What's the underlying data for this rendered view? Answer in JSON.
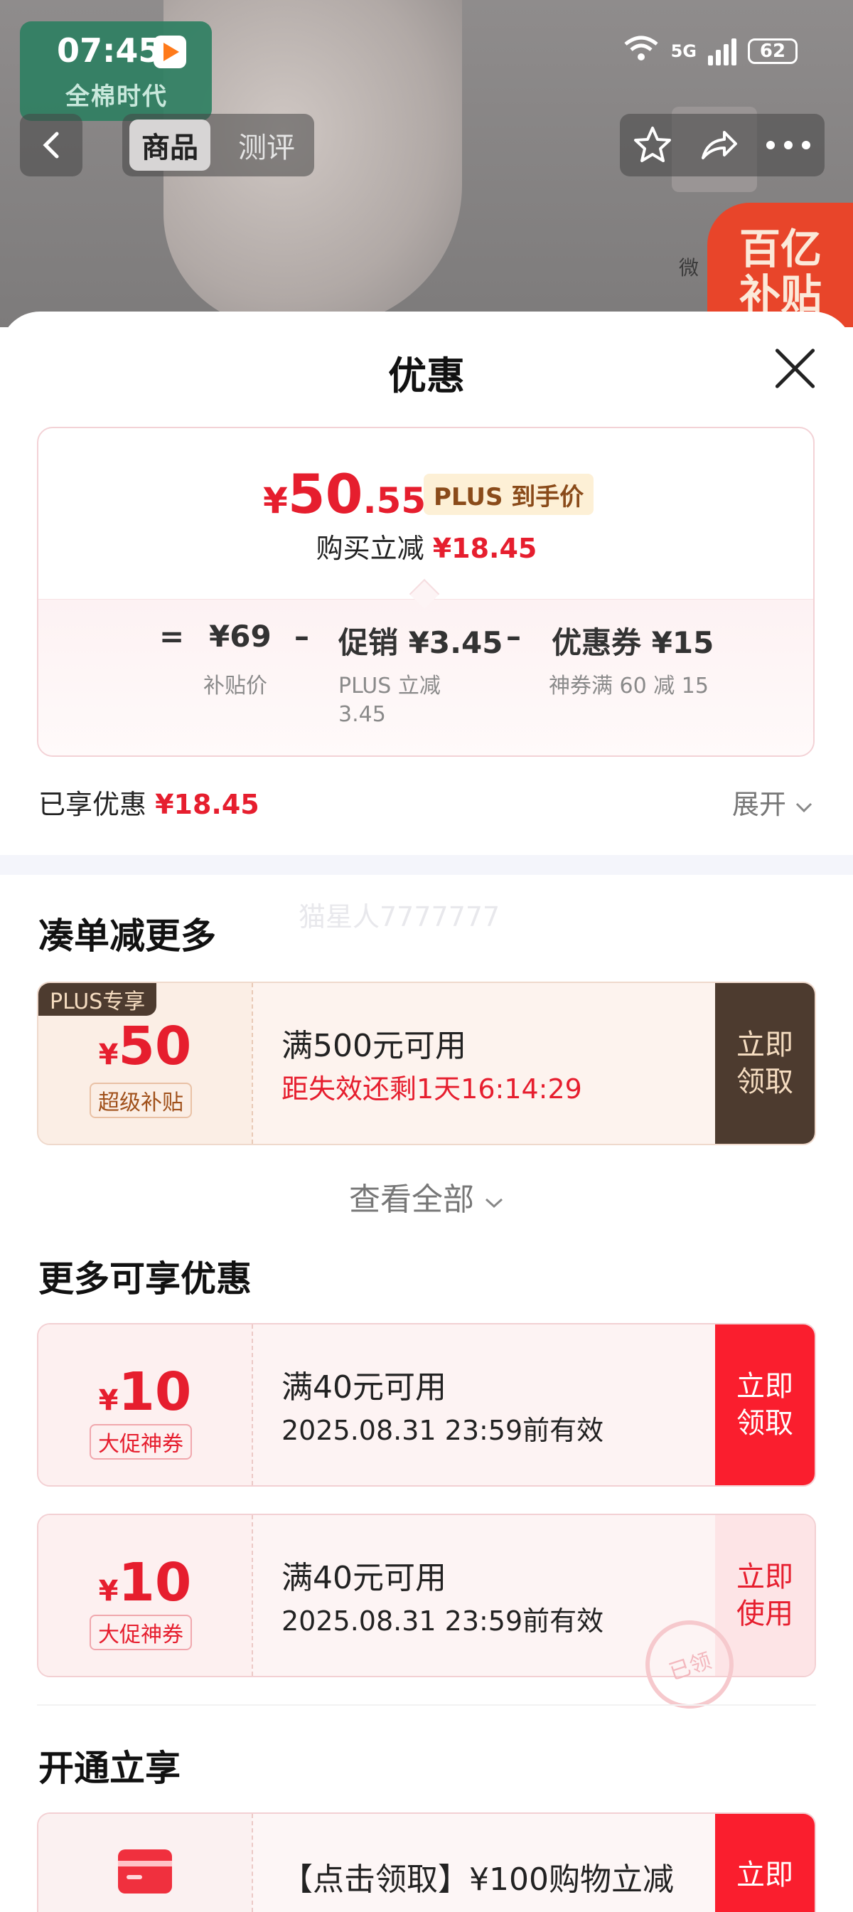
{
  "status_bar": {
    "time": "07:45",
    "network": "5G",
    "battery": "62"
  },
  "product_bg": {
    "brand_subtitle": "全棉时代",
    "thumb_label": "微",
    "subsidy_badge": [
      "百亿",
      "补贴"
    ]
  },
  "nav": {
    "tabs": [
      "商品",
      "测评"
    ],
    "active_tab": "商品"
  },
  "sheet": {
    "title": "优惠"
  },
  "summary": {
    "currency": "¥",
    "price_int": "50",
    "price_dec": ".55",
    "price_badge": "PLUS 到手价",
    "saving_label": "购买立减",
    "saving_value": "¥18.45",
    "breakdown": [
      {
        "op": "=",
        "value": "¥69",
        "label": "补贴价"
      },
      {
        "op": "–",
        "value": "促销 ¥3.45",
        "label": "PLUS 立减\n3.45"
      },
      {
        "op": "–",
        "value": "优惠券 ¥15",
        "label": "神券满 60 减 15"
      }
    ]
  },
  "enjoyed": {
    "label": "已享优惠",
    "value": "¥18.45",
    "expand": "展开"
  },
  "section_combine": {
    "title": "凑单减更多",
    "watermark": "猫星人7777777"
  },
  "plus_coupon": {
    "corner_tag": "PLUS专享",
    "currency": "¥",
    "amount": "50",
    "tag": "超级补贴",
    "condition": "满500元可用",
    "countdown": "距失效还剩1天16:14:29",
    "action": "立即\n领取"
  },
  "view_all": "查看全部",
  "section_more": {
    "title": "更多可享优惠"
  },
  "coupons": [
    {
      "currency": "¥",
      "amount": "10",
      "tag": "大促神券",
      "condition": "满40元可用",
      "validity": "2025.08.31 23:59前有效",
      "action": "立即\n领取"
    },
    {
      "currency": "¥",
      "amount": "10",
      "tag": "大促神券",
      "condition": "满40元可用",
      "validity": "2025.08.31 23:59前有效",
      "action": "立即\n使用",
      "stamp": "已领"
    }
  ],
  "section_open": {
    "title": "开通立享"
  },
  "open_offer": {
    "text": "【点击领取】¥100购物立减",
    "action": "立即"
  },
  "colors": {
    "accent_red": "#e61e2e",
    "button_red": "#fa1e2e",
    "plus_dark": "#4d3b2f"
  }
}
